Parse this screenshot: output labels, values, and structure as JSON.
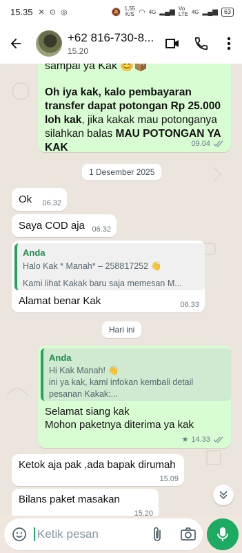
{
  "status_bar": {
    "time": "15.35",
    "battery": "63",
    "speed": "1,55",
    "speed_unit": "K/S",
    "net1": "4G",
    "net2": "4G",
    "lte": "Vo LTE"
  },
  "header": {
    "title": "+62 816-730-8...",
    "subtitle": "15.20"
  },
  "messages": {
    "m1": {
      "text_part1": "sampai ya Kak 😊📦"
    },
    "m2": {
      "bold1": "Oh iya kak, kalo pembayaran transfer dapat potongan Rp 25.000 loh kak",
      "normal": ", jika kakak mau potonganya silahkan balas ",
      "bold2": "MAU POTONGAN YA KAK",
      "time": "09.04"
    },
    "date1": "1 Desember 2025",
    "m3": {
      "text": "Ok",
      "time": "06.32"
    },
    "m4": {
      "text": "Saya COD aja",
      "time": "06.32"
    },
    "m5": {
      "quote_name": "Anda",
      "quote_line1": "Halo Kak * Manah* – 258817252 👋",
      "quote_line2": "Kami lihat Kakak baru saja memesan M...",
      "text": "Alamat benar Kak",
      "time": "06.33"
    },
    "date2": "Hari ini",
    "m6": {
      "quote_name": "Anda",
      "quote_line1": "Hi Kak Manah! 👋",
      "quote_line2": "ini ya kak, kami infokan kembali detail",
      "quote_line3": "pesanan Kakak:...",
      "text_line1": "Selamat siang kak",
      "text_line2": "Mohon paketnya diterima ya kak",
      "time": "14.33"
    },
    "m7": {
      "text": "Ketok aja pak ,ada bapak dirumah",
      "time": "15.09"
    },
    "m8": {
      "text": "Bilans paket masakan",
      "time": "15.20"
    }
  },
  "composer": {
    "placeholder": "Ketik pesan"
  },
  "colors": {
    "outgoing": "#d9fdd3",
    "incoming": "#ffffff",
    "accent": "#1daa61",
    "ticks": "#8696a0"
  },
  "icons": [
    "back-arrow-icon",
    "video-call-icon",
    "phone-call-icon",
    "more-vert-icon",
    "emoji-sticker-icon",
    "attach-icon",
    "camera-icon",
    "mic-icon",
    "scroll-down-icon",
    "star-icon",
    "double-tick-icon"
  ]
}
